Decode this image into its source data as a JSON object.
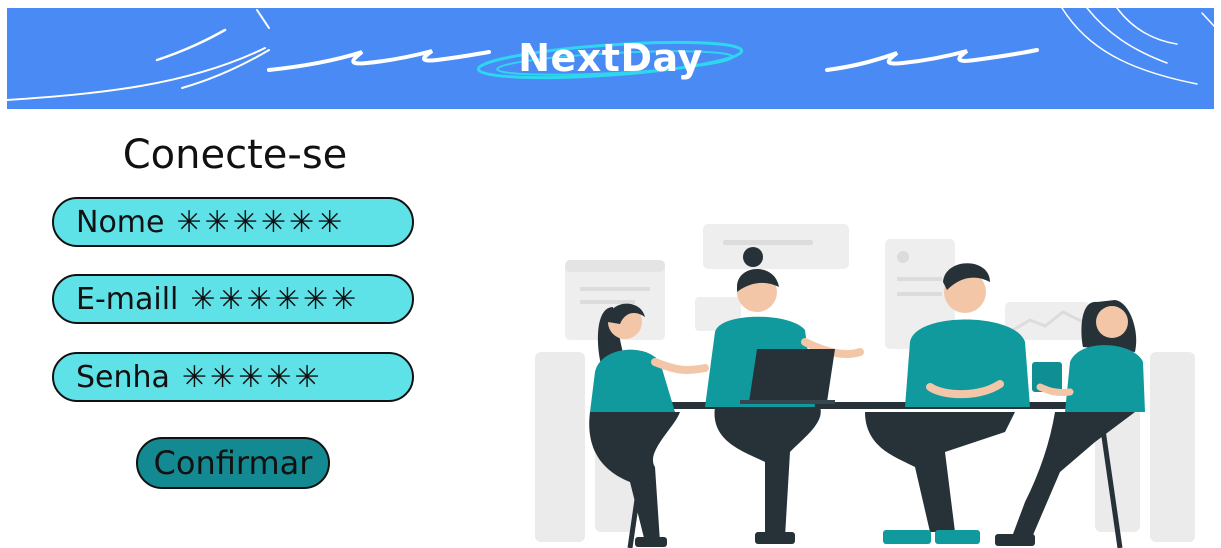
{
  "header": {
    "brand": "NextDay",
    "color": "#4a8af5"
  },
  "login": {
    "title": "Conecte-se",
    "fields": [
      {
        "label": "Nome",
        "value": "✳✳✳✳✳✳"
      },
      {
        "label": "E-maill",
        "value": "✳✳✳✳✳✳"
      },
      {
        "label": "Senha",
        "value": "✳✳✳✳✳"
      }
    ],
    "submit_label": "Confirmar",
    "field_color": "#5fe1e8",
    "button_color": "#138a92"
  },
  "illustration": {
    "name": "team-meeting-illustration",
    "accent": "#109a9e"
  }
}
